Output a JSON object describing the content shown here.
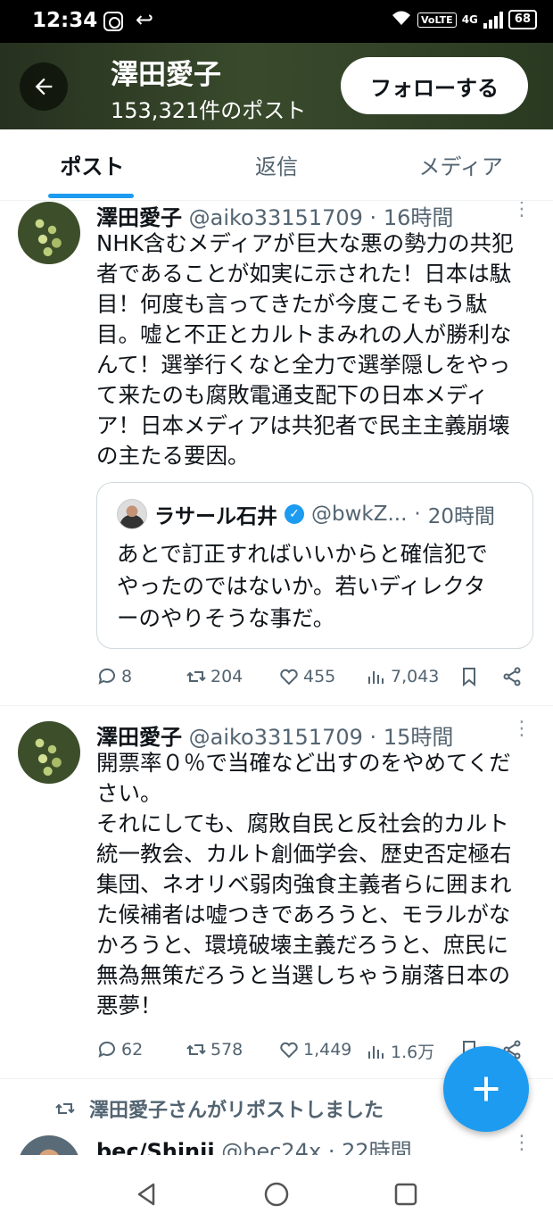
{
  "status_bar": {
    "time": "12:34",
    "network": "4G",
    "volte": "VoLTE",
    "battery": "68"
  },
  "header": {
    "name": "澤田愛子",
    "post_count": "153,321件のポスト",
    "follow_label": "フォローする"
  },
  "tabs": [
    {
      "label": "ポスト",
      "active": true
    },
    {
      "label": "返信",
      "active": false
    },
    {
      "label": "メディア",
      "active": false
    }
  ],
  "tweets": [
    {
      "name": "澤田愛子",
      "handle": "@aiko33151709",
      "time": "16時間",
      "text": "NHK含むメディアが巨大な悪の勢力の共犯\n者であることが如実に示された！日本は駄\n目！何度も言ってきたが今度こそもう駄\n目。嘘と不正とカルトまみれの人が勝利な\nんて！選挙行くなと全力で選挙隠しをやっ\nて来たのも腐敗電通支配下の日本メディ\nア！日本メディアは共犯者で民主主義崩壊\nの主たる要因。",
      "quote": {
        "name": "ラサール石井",
        "handle": "@bwkZ...",
        "time": "20時間",
        "text": "あとで訂正すればいいからと確信犯で\nやったのではないか。若いディレクタ\nーのやりそうな事だ。"
      },
      "replies": "8",
      "reposts": "204",
      "likes": "455",
      "views": "7,043"
    },
    {
      "name": "澤田愛子",
      "handle": "@aiko33151709",
      "time": "15時間",
      "text": "開票率０％で当確など出すのをやめてくだ\nさい。\nそれにしても、腐敗自民と反社会的カルト\n統一教会、カルト創価学会、歴史否定極右\n集団、ネオリベ弱肉強食主義者らに囲まれ\nた候補者は嘘つきであろうと、モラルがな\nかろうと、環境破壊主義だろうと、庶民に\n無為無策だろうと当選しちゃう崩落日本の\n悪夢！",
      "replies": "62",
      "reposts": "578",
      "likes": "1,449",
      "views": "1.6万"
    }
  ],
  "repost_notice": "澤田愛子さんがリポストしました",
  "third_tweet": {
    "name": "bec/Shinii",
    "handle": "@bec24x",
    "time": "22時間"
  },
  "colors": {
    "accent": "#1d9bf0",
    "secondary_text": "#536471",
    "header_bg": "#394a2c"
  }
}
